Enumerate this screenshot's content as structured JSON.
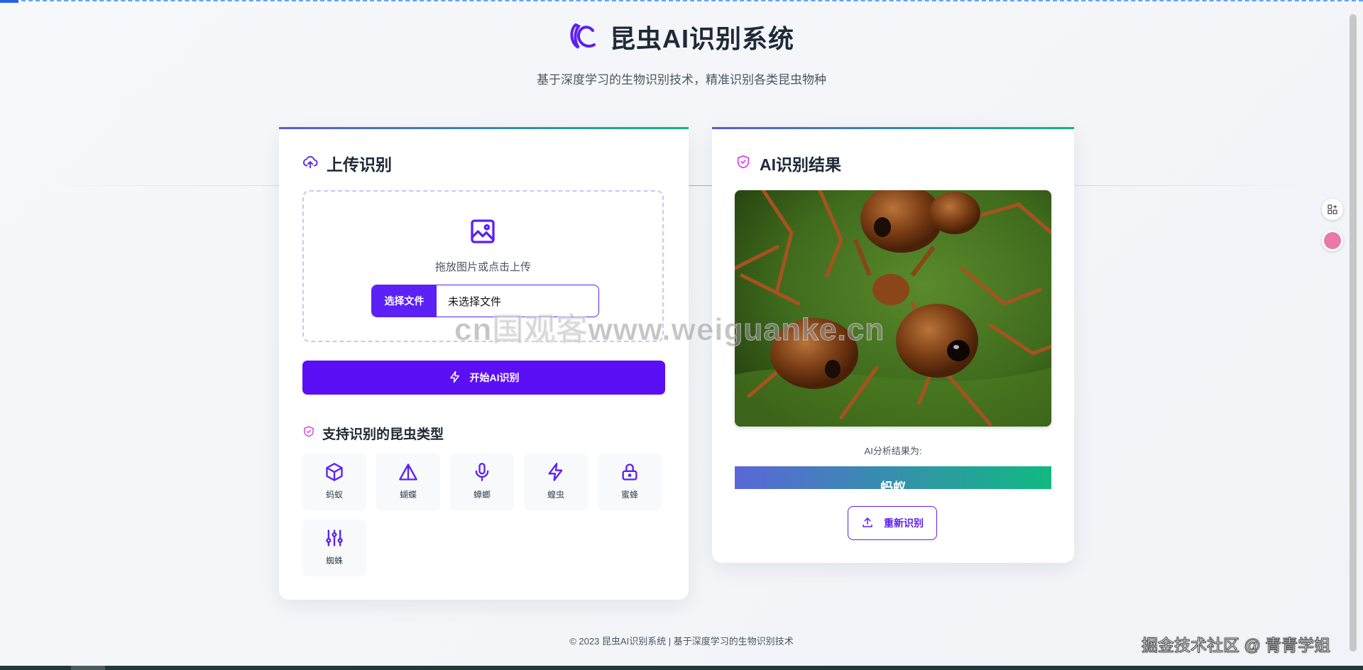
{
  "app": {
    "title": "昆虫AI识别系统",
    "subtitle": "基于深度学习的生物识别技术，精准识别各类昆虫物种",
    "logo_icon": "crescent-logo-icon"
  },
  "upload_card": {
    "title": "上传识别",
    "icon": "cloud-upload-icon",
    "dropzone_text": "拖放图片或点击上传",
    "file_button_label": "选择文件",
    "file_status": "未选择文件",
    "start_button_label": "开始AI识别"
  },
  "supported": {
    "title": "支持识别的昆虫类型",
    "types": [
      {
        "label": "蚂蚁",
        "icon": "box-icon"
      },
      {
        "label": "蝴蝶",
        "icon": "triangle-icon"
      },
      {
        "label": "蟑螂",
        "icon": "microphone-icon"
      },
      {
        "label": "蝗虫",
        "icon": "lightning-icon"
      },
      {
        "label": "蜜蜂",
        "icon": "lock-icon"
      },
      {
        "label": "蜘蛛",
        "icon": "sliders-icon"
      }
    ]
  },
  "result_card": {
    "title": "AI识别结果",
    "icon": "shield-check-icon",
    "result_label": "AI分析结果为:",
    "result_value": "蚂蚁",
    "retry_button_label": "重新识别"
  },
  "watermark": "cn国观客www.weiguanke.cn",
  "footer": "© 2023 昆虫AI识别系统 | 基于深度学习的生物识别技术",
  "credit": "掘金技术社区 @ 青青学姐",
  "colors": {
    "primary": "#5b0ff5",
    "accent_green": "#10b981",
    "accent_indigo": "#5a67d8",
    "shield_pink": "#d946ef"
  }
}
